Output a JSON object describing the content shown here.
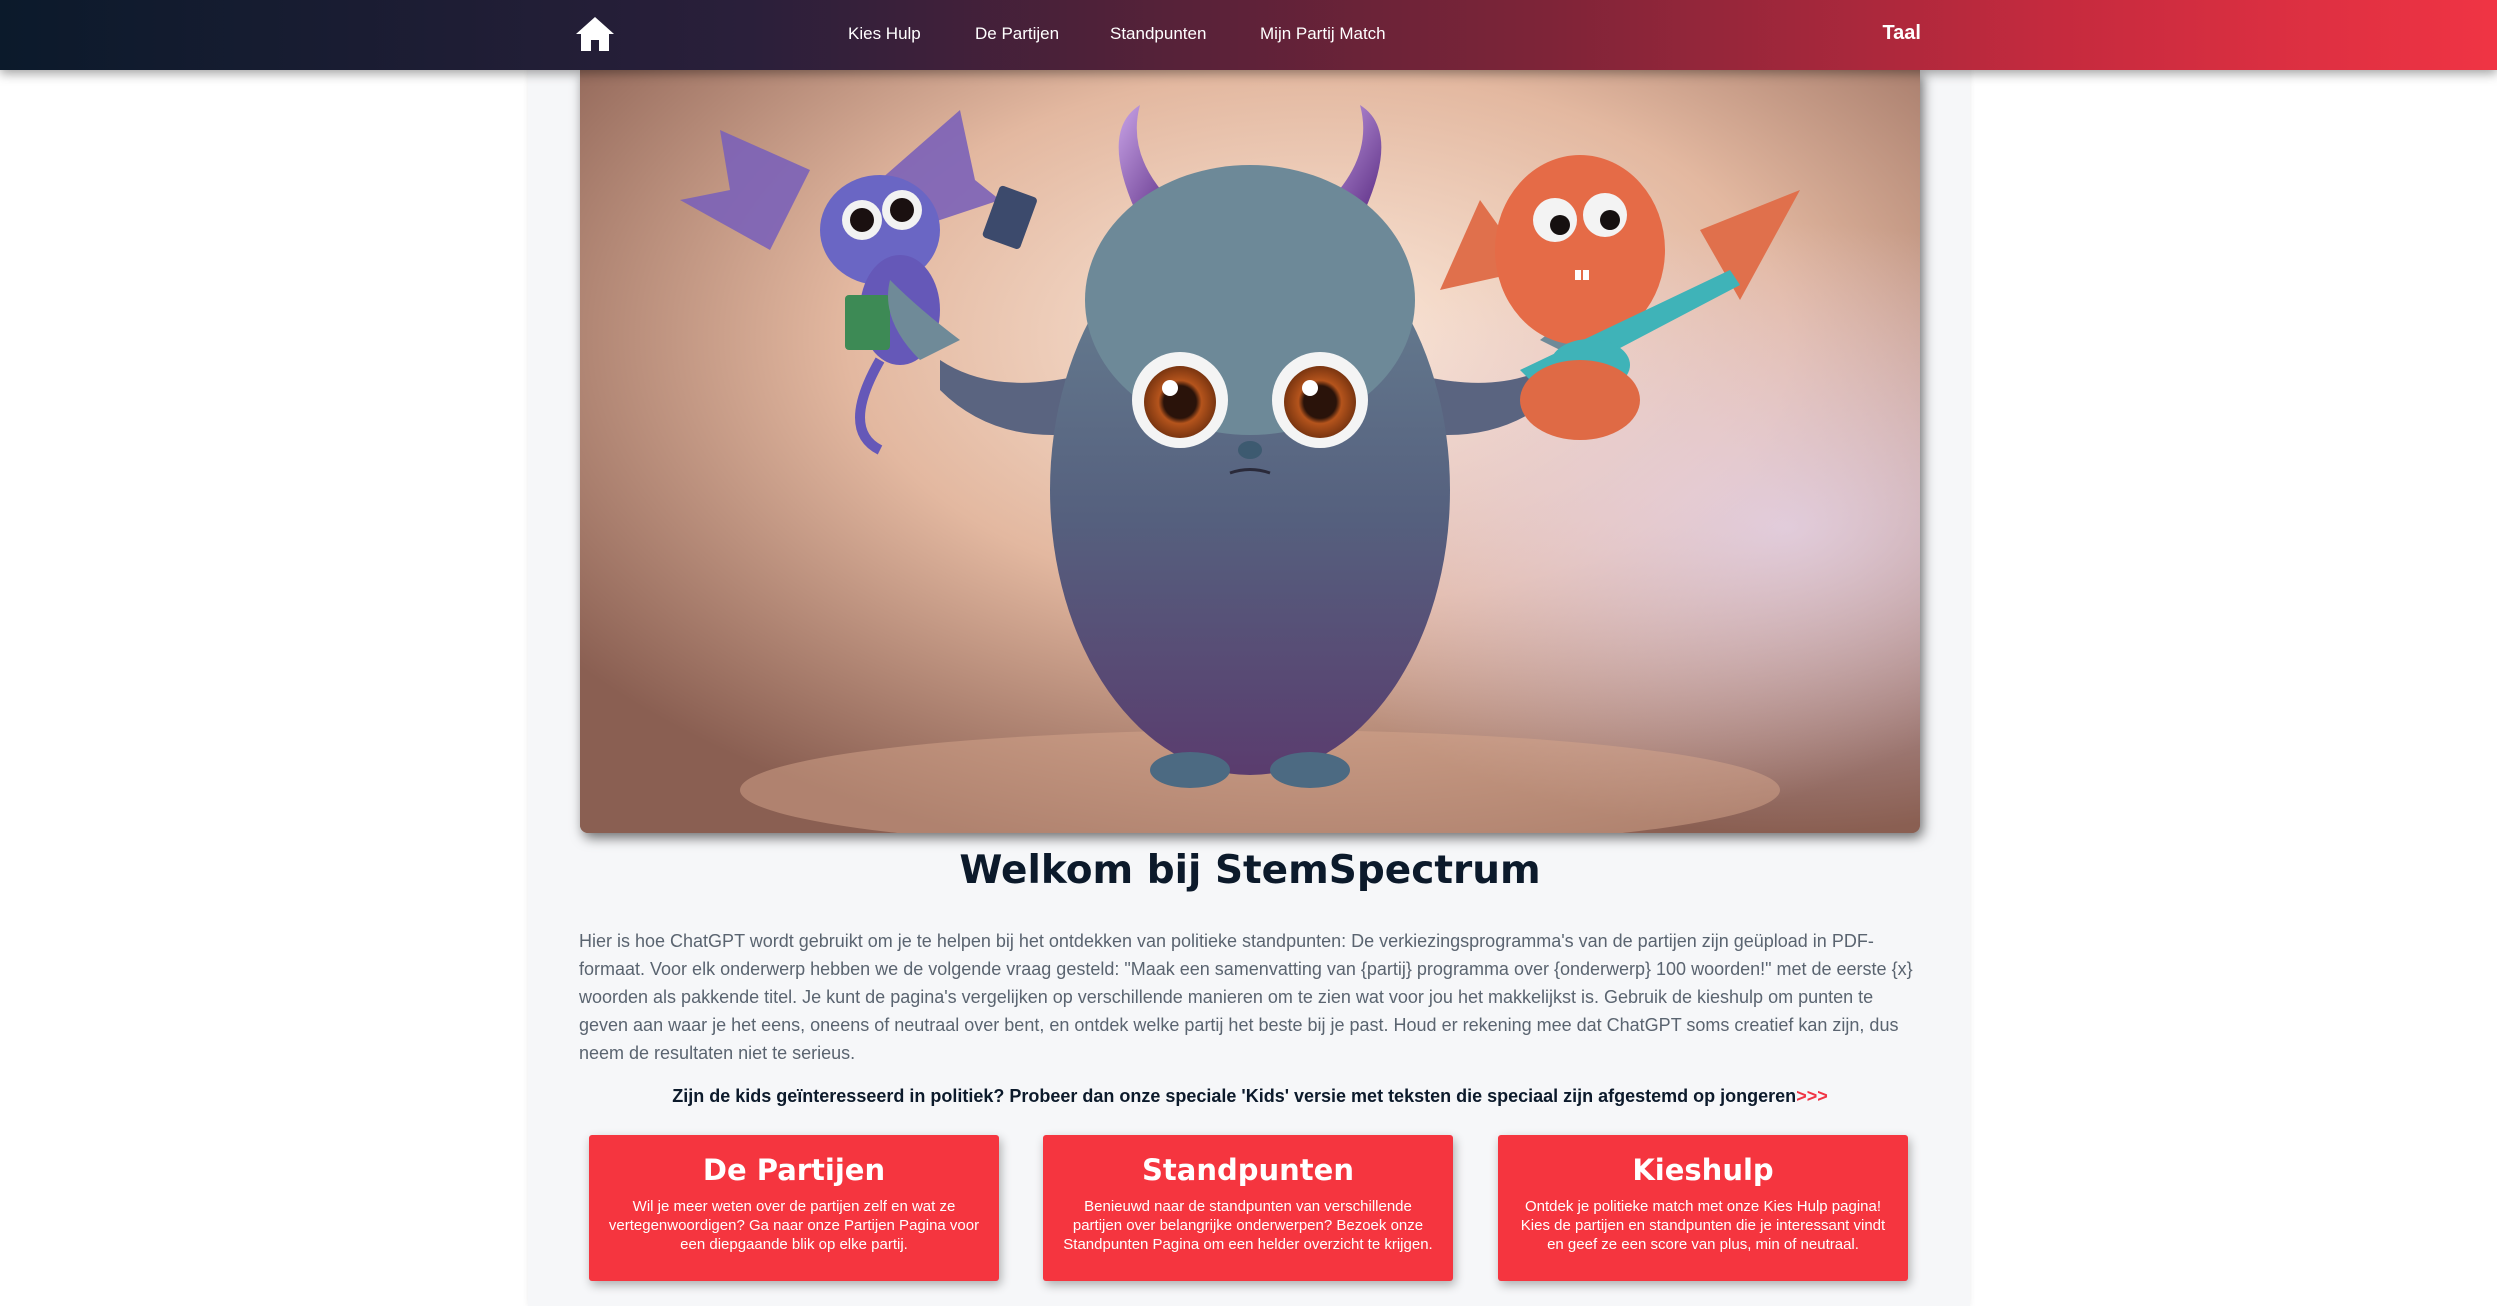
{
  "nav": {
    "home_icon": "home-icon",
    "links": [
      "Kies Hulp",
      "De Partijen",
      "Standpunten",
      "Mijn Partij Match"
    ],
    "language": "Taal"
  },
  "hero": {
    "image": "three-fluffy-monsters-illustration"
  },
  "welcome": {
    "title": "Welkom bij StemSpectrum",
    "intro": "Hier is hoe ChatGPT wordt gebruikt om je te helpen bij het ontdekken van politieke standpunten: De verkiezingsprogramma's van de partijen zijn geüpload in PDF-formaat. Voor elk onderwerp hebben we de volgende vraag gesteld: \"Maak een samenvatting van {partij} programma over {onderwerp} 100 woorden!\" met de eerste {x} woorden als pakkende titel. Je kunt de pagina's vergelijken op verschillende manieren om te zien wat voor jou het makkelijkst is. Gebruik de kieshulp om punten te geven aan waar je het eens, oneens of neutraal over bent, en ontdek welke partij het beste bij je past. Houd er rekening mee dat ChatGPT soms creatief kan zijn, dus neem de resultaten niet te serieus.",
    "kids_text": "Zijn de kids geïnteresseerd in politiek? Probeer dan onze speciale 'Kids' versie met teksten die speciaal zijn afgestemd op jongeren",
    "kids_link": ">>>"
  },
  "cards": [
    {
      "title": "De Partijen",
      "text": "Wil je meer weten over de partijen zelf en wat ze vertegenwoordigen? Ga naar onze Partijen Pagina voor een diepgaande blik op elke partij."
    },
    {
      "title": "Standpunten",
      "text": "Benieuwd naar de standpunten van verschillende partijen over belangrijke onderwerpen? Bezoek onze Standpunten Pagina om een helder overzicht te krijgen."
    },
    {
      "title": "Kieshulp",
      "text": "Ontdek je politieke match met onze Kies Hulp pagina! Kies de partijen en standpunten die je interessant vindt en geef ze een score van plus, min of neutraal."
    }
  ],
  "colors": {
    "accent": "#f5353f",
    "navy": "#0c1a2b",
    "body_text": "#5a6470"
  }
}
